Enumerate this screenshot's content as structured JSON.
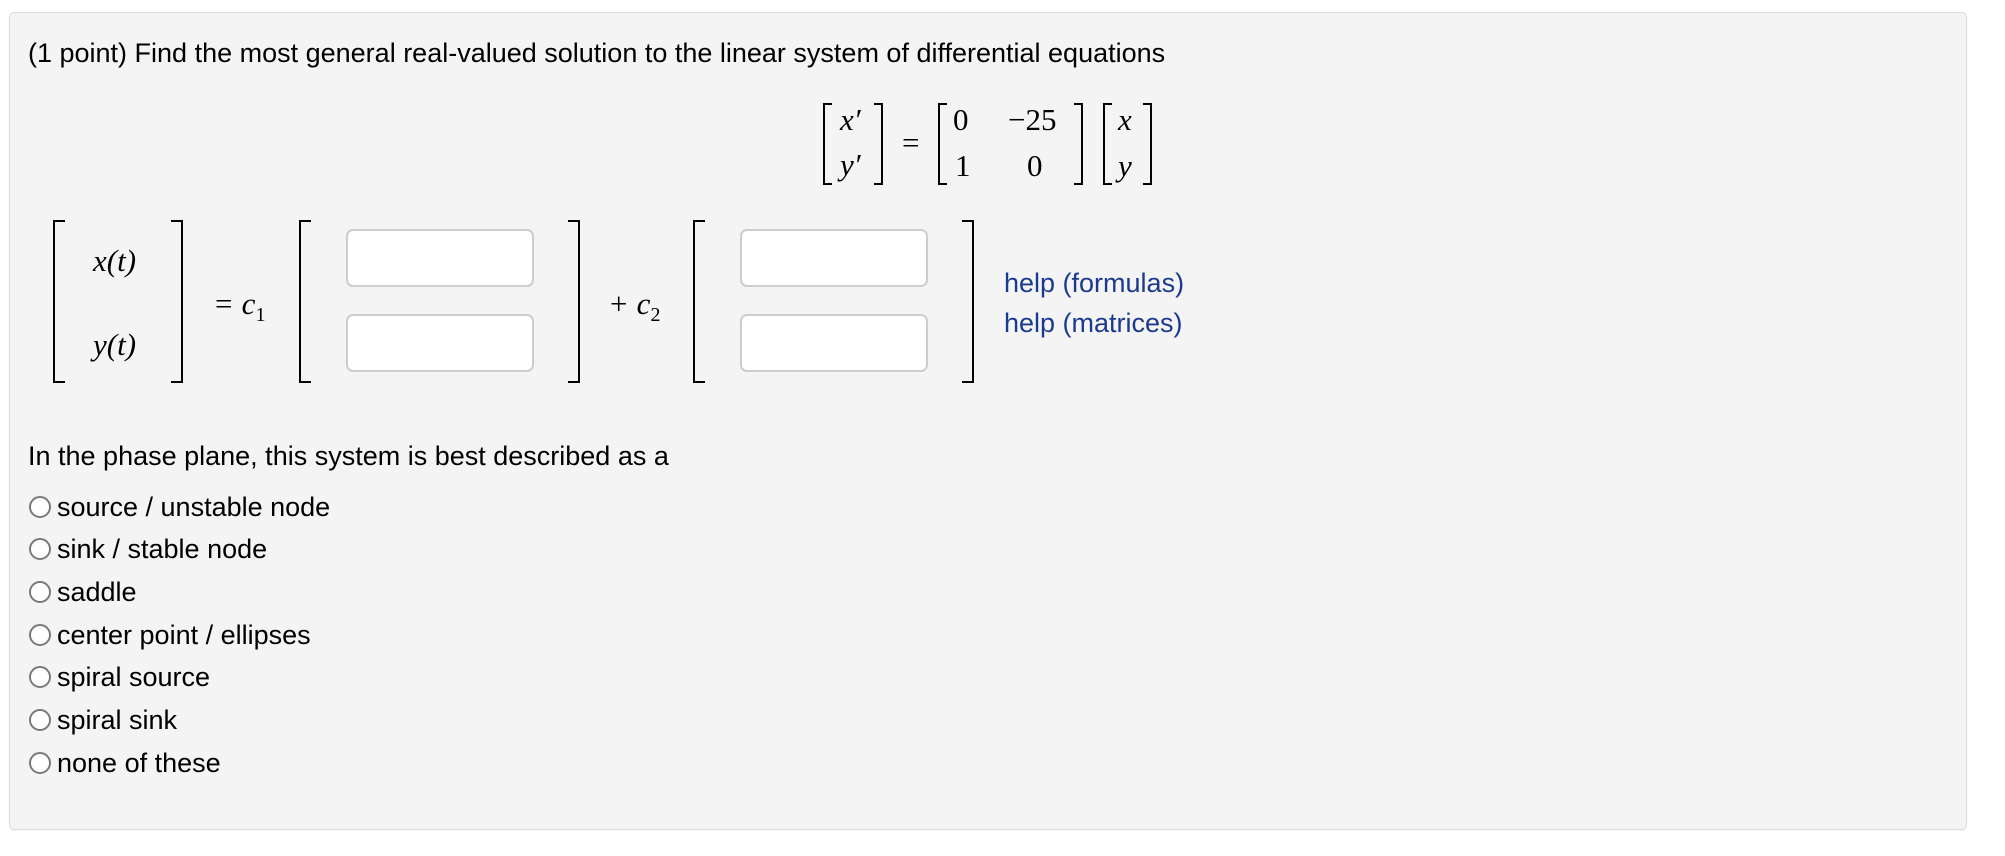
{
  "problem": {
    "prompt": "(1 point) Find the most general real-valued solution to the linear system of differential equations",
    "system": {
      "lhs": [
        "x′",
        "y′"
      ],
      "equals": "=",
      "matrix": [
        [
          "0",
          "−25"
        ],
        [
          "1",
          "0"
        ]
      ],
      "vector": [
        "x",
        "y"
      ]
    },
    "solution": {
      "lhs": [
        "x(t)",
        "y(t)"
      ],
      "equals_c1": "= c",
      "c1_sub": "1",
      "plus_c2": "+ c",
      "c2_sub": "2",
      "vector1": [
        {
          "value": "",
          "placeholder": ""
        },
        {
          "value": "",
          "placeholder": ""
        }
      ],
      "vector2": [
        {
          "value": "",
          "placeholder": ""
        },
        {
          "value": "",
          "placeholder": ""
        }
      ]
    },
    "help_links": [
      {
        "label": "help (formulas)"
      },
      {
        "label": "help (matrices)"
      }
    ],
    "phase_question": "In the phase plane, this system is best described as a",
    "options": [
      {
        "label": "source / unstable node",
        "selected": false
      },
      {
        "label": "sink / stable node",
        "selected": false
      },
      {
        "label": "saddle",
        "selected": false
      },
      {
        "label": "center point / ellipses",
        "selected": false
      },
      {
        "label": "spiral source",
        "selected": false
      },
      {
        "label": "spiral sink",
        "selected": false
      },
      {
        "label": "none of these",
        "selected": false
      }
    ]
  },
  "colors": {
    "panel_background": "#f4f4f4",
    "link": "#1a3a8e",
    "input_border": "#cdcdcd"
  }
}
